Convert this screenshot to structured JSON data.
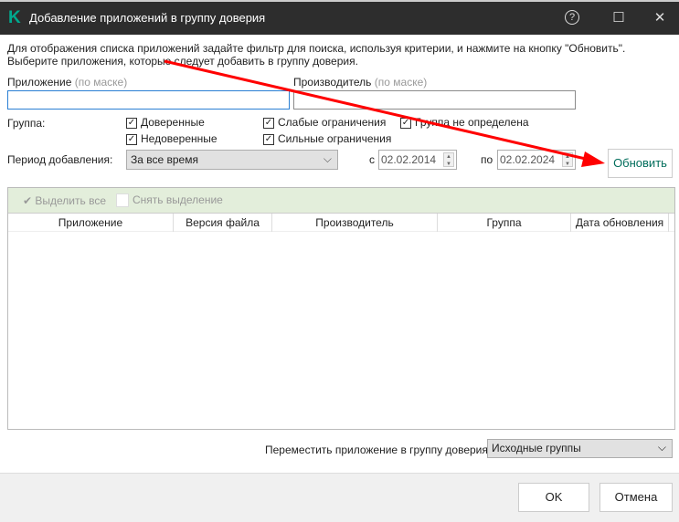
{
  "window": {
    "title": "Добавление приложений в группу доверия",
    "logo": "K",
    "help_icon": "?",
    "max_icon": "☐",
    "close_icon": "✕"
  },
  "intro": [
    "Для отображения списка приложений задайте фильтр для поиска, используя критерии, и нажмите на кнопку \"Обновить\".",
    "Выберите приложения, которые следует добавить в группу доверия."
  ],
  "filters": {
    "app_label": "Приложение",
    "app_hint": "(по маске)",
    "vendor_label": "Производитель",
    "vendor_hint": "(по маске)",
    "app_value": "",
    "vendor_value": "",
    "group_label": "Группа:",
    "groups": [
      "Доверенные",
      "Слабые ограничения",
      "Группа не определена",
      "Недоверенные",
      "Сильные ограничения"
    ],
    "period_label": "Период добавления:",
    "period_value": "За все время",
    "from_label": "с",
    "from_value": "02.02.2014",
    "to_label": "по",
    "to_value": "02.02.2024"
  },
  "refresh": "Обновить",
  "toolbar": {
    "select_all": "Выделить все",
    "deselect": "Снять выделение"
  },
  "table": {
    "columns": [
      "Приложение",
      "Версия файла",
      "Производитель",
      "Группа",
      "Дата обновления"
    ],
    "rows": []
  },
  "move": {
    "label": "Переместить приложение в группу доверия:",
    "value": "Исходные группы"
  },
  "buttons": {
    "ok": "OK",
    "cancel": "Отмена"
  },
  "colors": {
    "accent": "#00a88e",
    "annotation_arrow": "#ff0000"
  }
}
